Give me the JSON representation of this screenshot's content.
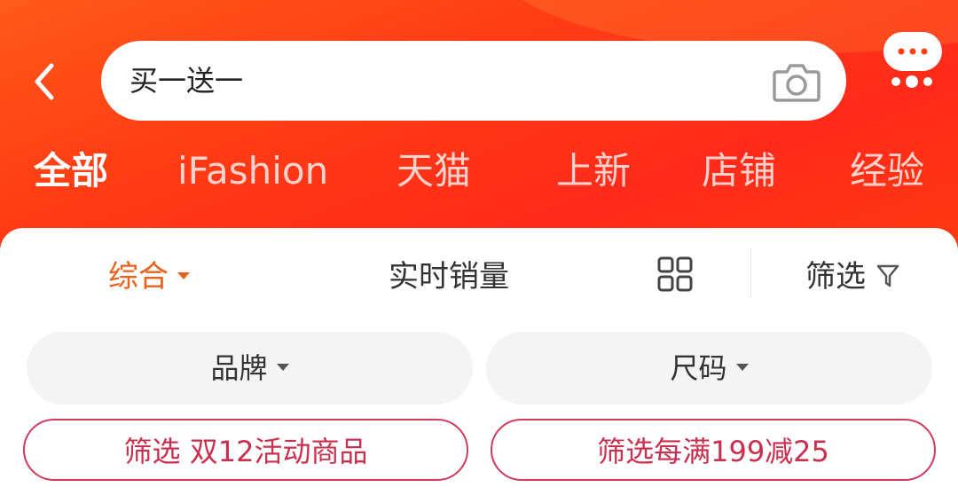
{
  "header": {
    "search_value": "买一送一",
    "back_icon": "back-arrow-icon",
    "camera_icon": "camera-icon",
    "more_icon": "more-menu-icon"
  },
  "tabs": [
    {
      "label": "全部",
      "active": true
    },
    {
      "label": "iFashion",
      "active": false
    },
    {
      "label": "天猫",
      "active": false
    },
    {
      "label": "上新",
      "active": false
    },
    {
      "label": "店铺",
      "active": false
    },
    {
      "label": "经验",
      "active": false
    }
  ],
  "sortbar": {
    "comprehensive": "综合",
    "realtime_sales": "实时销量",
    "filter": "筛选",
    "layout_icon": "grid-view-icon",
    "filter_icon": "filter-funnel-icon"
  },
  "filters": {
    "brand": "品牌",
    "size": "尺码"
  },
  "promos": {
    "double12": "筛选 双12活动商品",
    "discount": "筛选每满199减25"
  },
  "colors": {
    "header_bg": "#ff3d14",
    "accent_orange": "#e8621c",
    "promo_border": "#d23a5a"
  }
}
